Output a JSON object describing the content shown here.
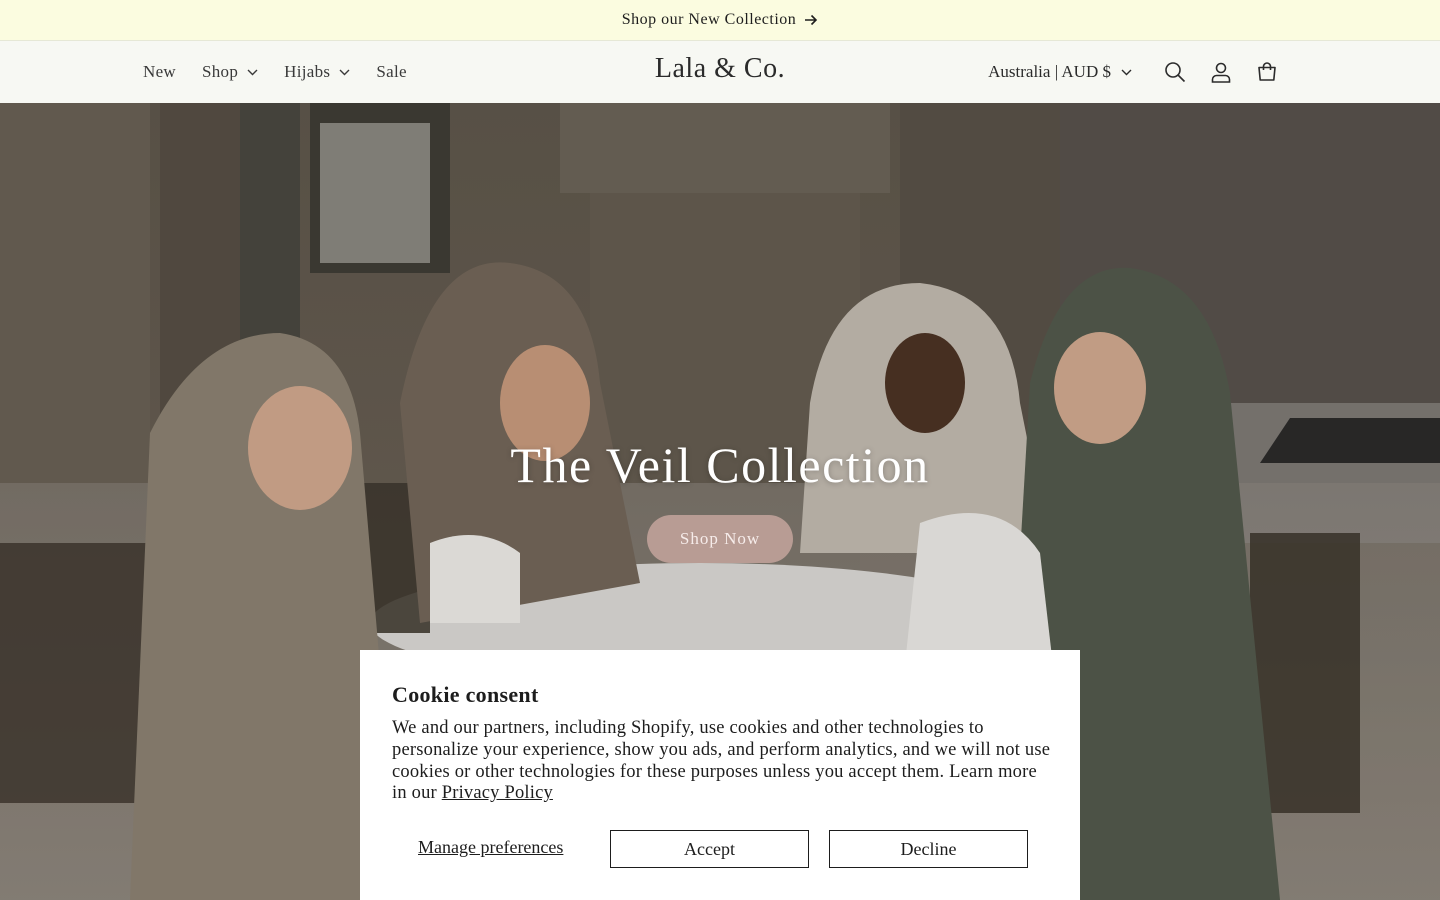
{
  "announcement": {
    "text": "Shop our New Collection",
    "icon": "arrow-right-icon"
  },
  "header": {
    "logo": "Lala & Co.",
    "nav": [
      {
        "label": "New",
        "has_dropdown": false
      },
      {
        "label": "Shop",
        "has_dropdown": true
      },
      {
        "label": "Hijabs",
        "has_dropdown": true
      },
      {
        "label": "Sale",
        "has_dropdown": false
      }
    ],
    "country_selector": "Australia | AUD $",
    "icons": [
      "search-icon",
      "account-icon",
      "cart-icon"
    ]
  },
  "hero": {
    "title": "The Veil Collection",
    "button_label": "Shop Now",
    "button_color": "#b89c94"
  },
  "cookie": {
    "title": "Cookie consent",
    "body": "We and our partners, including Shopify, use cookies and other technologies to personalize your experience, show you ads, and perform analytics, and we will not use cookies or other technologies for these purposes unless you accept them. Learn more in our",
    "privacy_link": "Privacy Policy",
    "manage_label": "Manage preferences",
    "accept_label": "Accept",
    "decline_label": "Decline"
  },
  "colors": {
    "announcement_bg": "#fbfce0",
    "header_bg": "#f7f8f3",
    "text": "#222222"
  }
}
